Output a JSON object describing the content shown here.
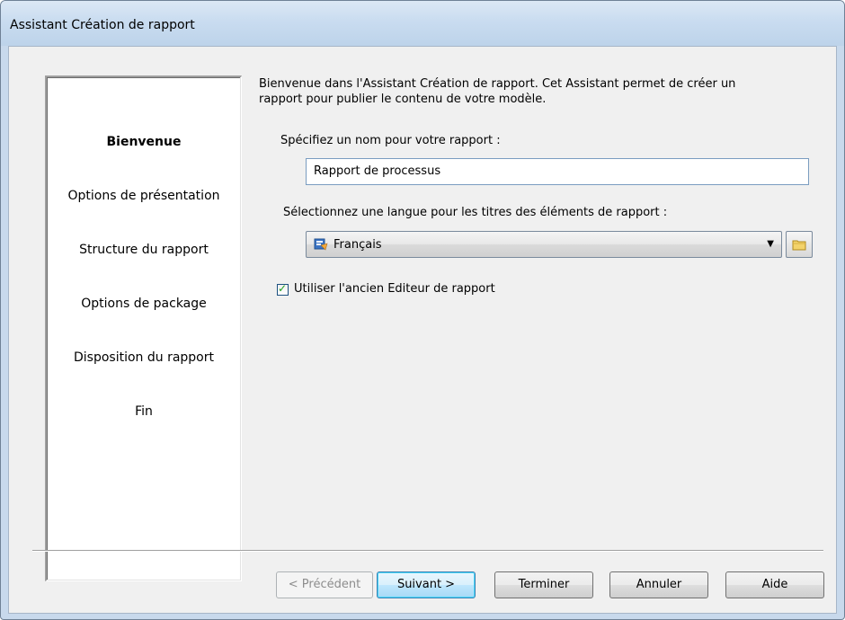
{
  "window": {
    "title": "Assistant Création de rapport"
  },
  "nav": {
    "items": [
      {
        "label": "Bienvenue",
        "active": true
      },
      {
        "label": "Options de présentation",
        "active": false
      },
      {
        "label": "Structure du rapport",
        "active": false
      },
      {
        "label": "Options de package",
        "active": false
      },
      {
        "label": "Disposition du rapport",
        "active": false
      },
      {
        "label": "Fin",
        "active": false
      }
    ]
  },
  "content": {
    "intro_line1": "Bienvenue dans l'Assistant Création de rapport. Cet Assistant permet de créer un",
    "intro_line2": "rapport pour publier le contenu de votre modèle.",
    "name_label": "Spécifiez un nom pour votre rapport :",
    "name_value": "Rapport de processus",
    "language_label": "Sélectionnez une langue pour les titres des éléments de rapport :",
    "language_value": "Français",
    "checkbox_label": "Utiliser l'ancien Editeur de rapport",
    "checkbox_checked": true
  },
  "buttons": {
    "previous": "< Précédent",
    "next": "Suivant >",
    "finish": "Terminer",
    "cancel": "Annuler",
    "help": "Aide"
  },
  "icons": {
    "language": "language-flag-icon",
    "folder": "folder-icon",
    "dropdown": "chevron-down-icon"
  }
}
